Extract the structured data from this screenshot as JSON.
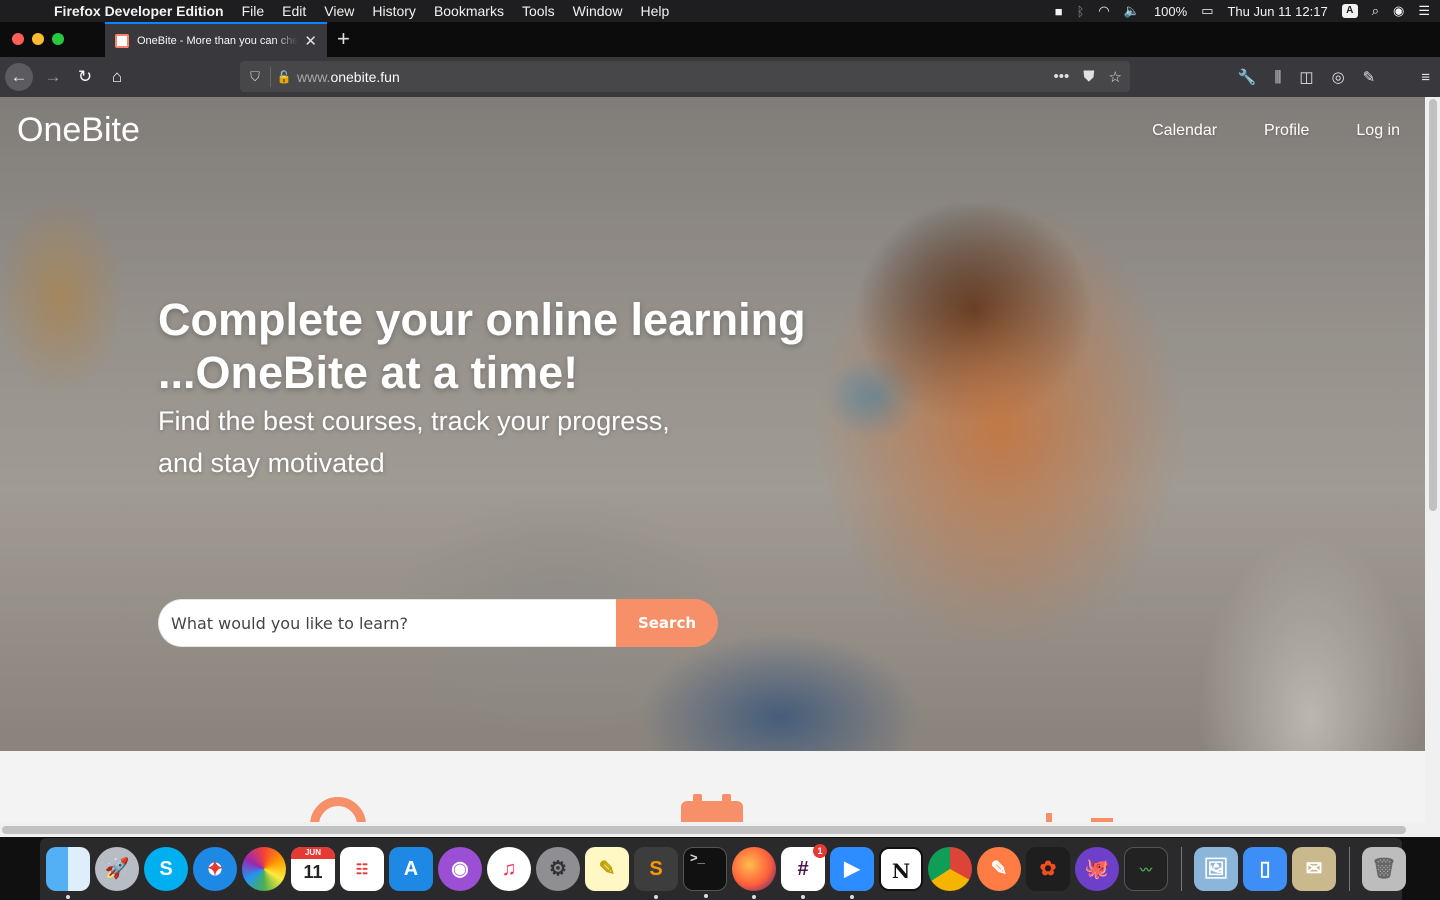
{
  "menubar": {
    "app_name": "Firefox Developer Edition",
    "menus": [
      "File",
      "Edit",
      "View",
      "History",
      "Bookmarks",
      "Tools",
      "Window",
      "Help"
    ],
    "battery": "100%",
    "datetime": "Thu Jun 11  12:17",
    "input_source": "A"
  },
  "browser": {
    "tab_title": "OneBite - More than you can chew",
    "url_domain_prefix": "www.",
    "url_domain": "onebite.fun"
  },
  "site": {
    "logo": "OneBite",
    "nav": {
      "calendar": "Calendar",
      "profile": "Profile",
      "login": "Log in"
    },
    "headline_line1": "Complete your online learning",
    "headline_line2": "...OneBite at a time!",
    "subhead_line1": "Find the best courses, track your progress,",
    "subhead_line2": "and stay motivated",
    "search": {
      "placeholder": "What would you like to learn?",
      "value": "",
      "button": "Search"
    }
  },
  "dock": {
    "calendar_day": "11",
    "slack_badge": "1",
    "terminal_prompt": ">_",
    "notion_letter": "N"
  },
  "colors": {
    "accent": "#f79068",
    "browser_chrome": "#38383d",
    "tab_highlight": "#0a84ff"
  }
}
